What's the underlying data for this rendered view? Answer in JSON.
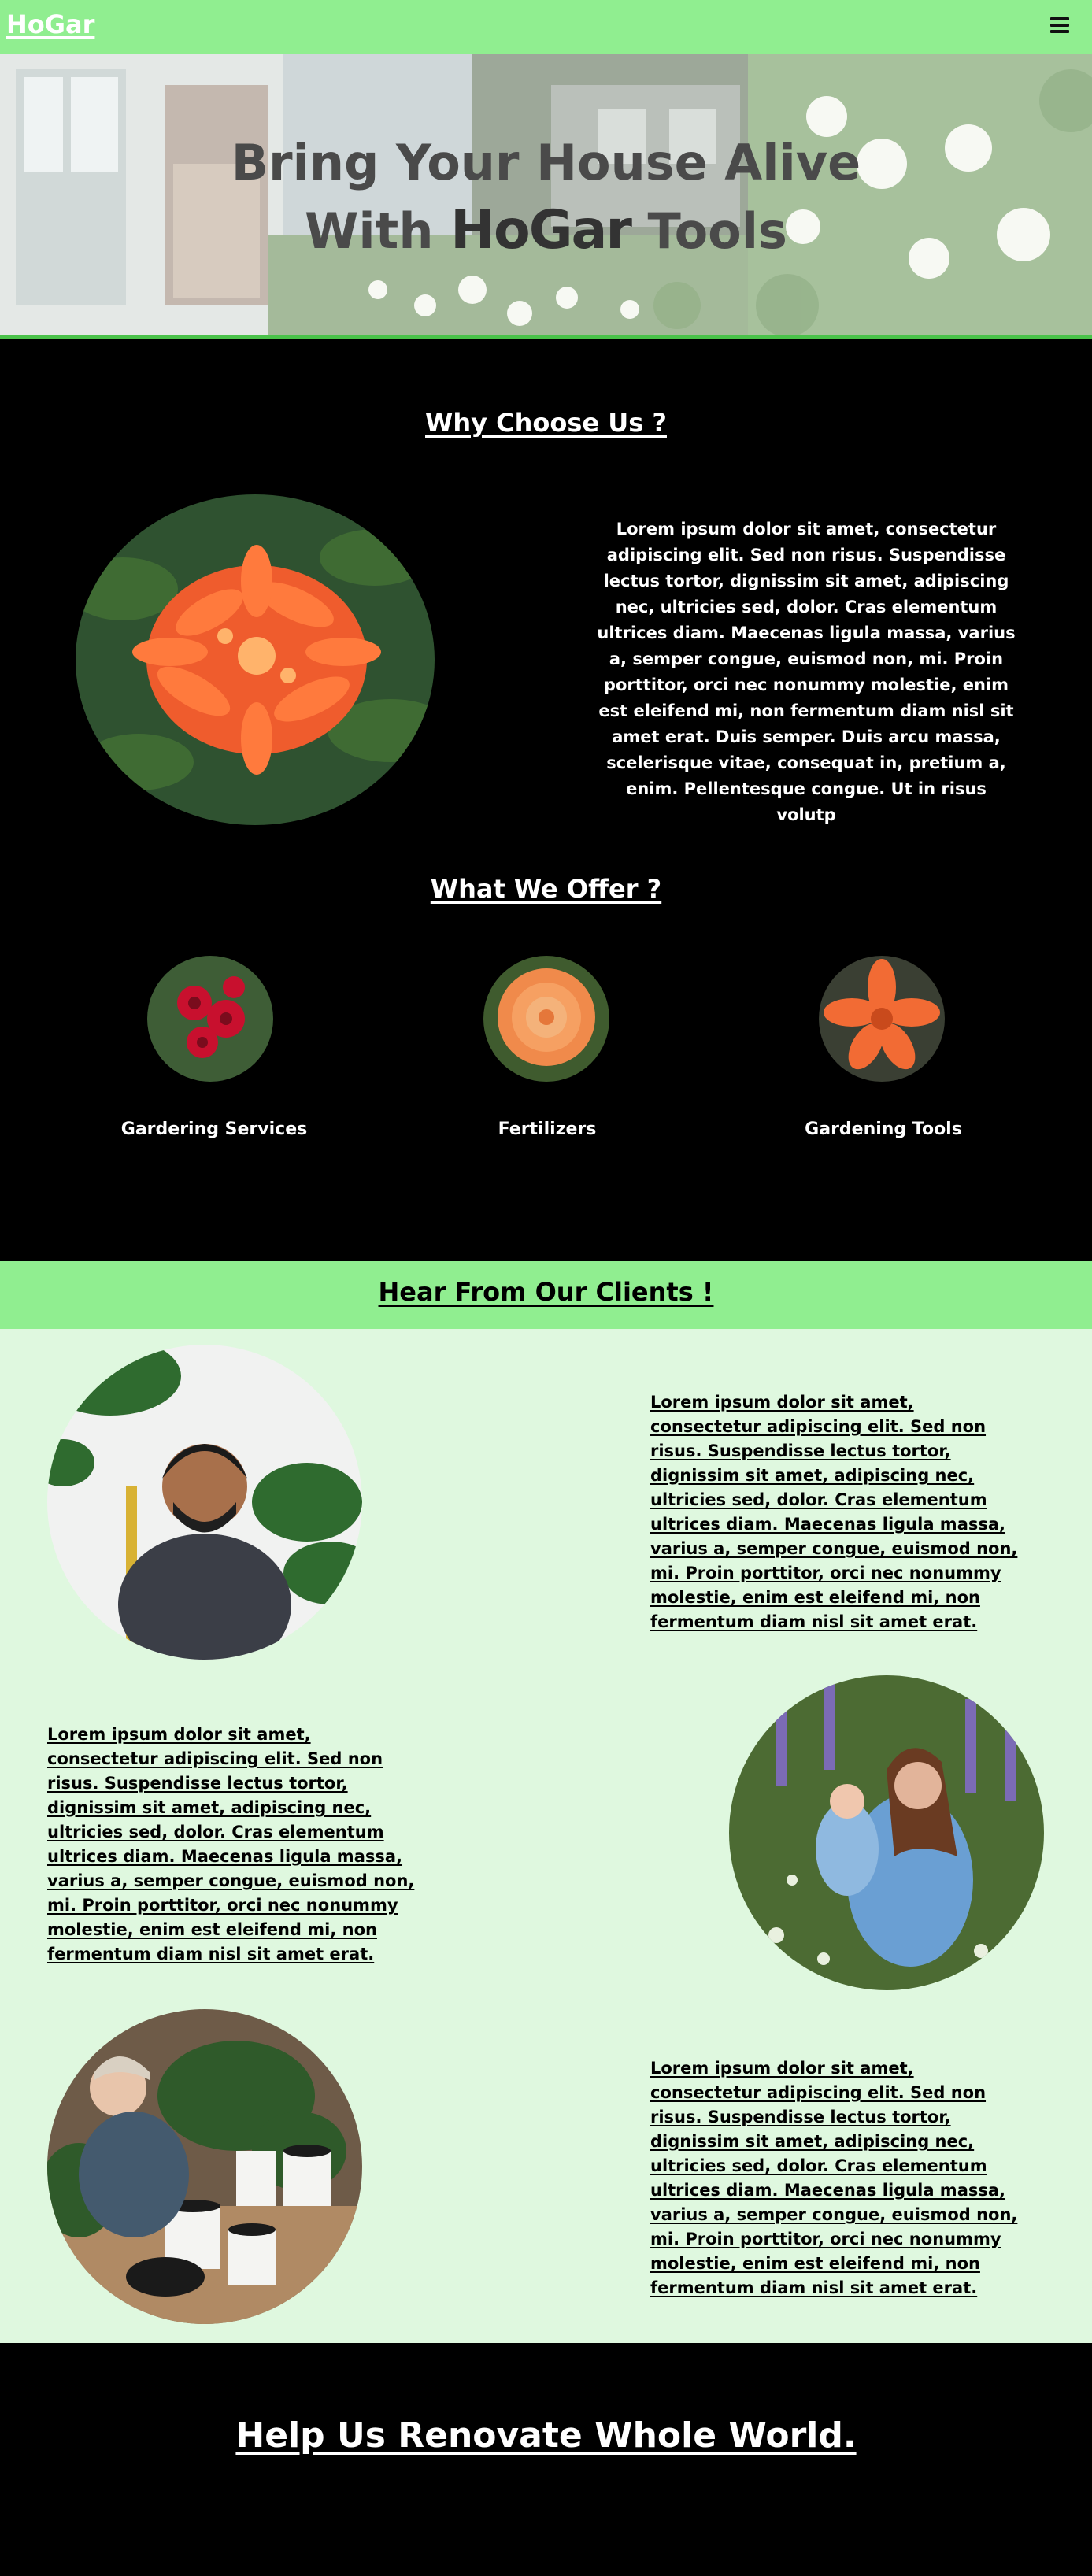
{
  "nav": {
    "logo": "HoGar",
    "menu_icon": "hamburger-menu-icon",
    "background": "#90ee90"
  },
  "hero": {
    "title_line1": "Bring Your House Alive",
    "title_line2_prefix": "With",
    "title_brand": "HoGar",
    "title_line2_suffix": "Tools"
  },
  "why": {
    "heading": "Why Choose Us ?",
    "text": "Lorem ipsum dolor sit amet, consectetur adipiscing elit. Sed non risus. Suspendisse lectus tortor, dignissim sit amet, adipiscing nec, ultricies sed, dolor. Cras elementum ultrices diam. Maecenas ligula massa, varius a, semper congue, euismod non, mi. Proin porttitor, orci nec nonummy molestie, enim est eleifend mi, non fermentum diam nisl sit amet erat. Duis semper. Duis arcu massa, scelerisque vitae, consequat in, pretium a, enim. Pellentesque congue. Ut in risus volutp"
  },
  "offer": {
    "heading": "What We Offer ?",
    "items": [
      {
        "label": "Gardering Services"
      },
      {
        "label": "Fertilizers"
      },
      {
        "label": "Gardening Tools"
      }
    ]
  },
  "clients": {
    "heading": "Hear From Our Clients !",
    "testimonials": [
      {
        "text": "Lorem ipsum dolor sit amet, consectetur adipiscing elit. Sed non risus. Suspendisse lectus tortor, dignissim sit amet, adipiscing nec, ultricies sed, dolor. Cras elementum ultrices diam. Maecenas ligula massa, varius a, semper congue, euismod non, mi. Proin porttitor, orci nec nonummy molestie, enim est eleifend mi, non fermentum diam nisl sit amet erat."
      },
      {
        "text": "Lorem ipsum dolor sit amet, consectetur adipiscing elit. Sed non risus. Suspendisse lectus tortor, dignissim sit amet, adipiscing nec, ultricies sed, dolor. Cras elementum ultrices diam. Maecenas ligula massa, varius a, semper congue, euismod non, mi. Proin porttitor, orci nec nonummy molestie, enim est eleifend mi, non fermentum diam nisl sit amet erat."
      },
      {
        "text": "Lorem ipsum dolor sit amet, consectetur adipiscing elit. Sed non risus. Suspendisse lectus tortor, dignissim sit amet, adipiscing nec, ultricies sed, dolor. Cras elementum ultrices diam. Maecenas ligula massa, varius a, semper congue, euismod non, mi. Proin porttitor, orci nec nonummy molestie, enim est eleifend mi, non fermentum diam nisl sit amet erat."
      }
    ]
  },
  "footer": {
    "heading": "Help Us Renovate Whole World."
  },
  "colors": {
    "accent": "#90ee90",
    "clients_bg": "#dff8df",
    "hero_border": "#4ac24a",
    "dark": "#000000"
  }
}
